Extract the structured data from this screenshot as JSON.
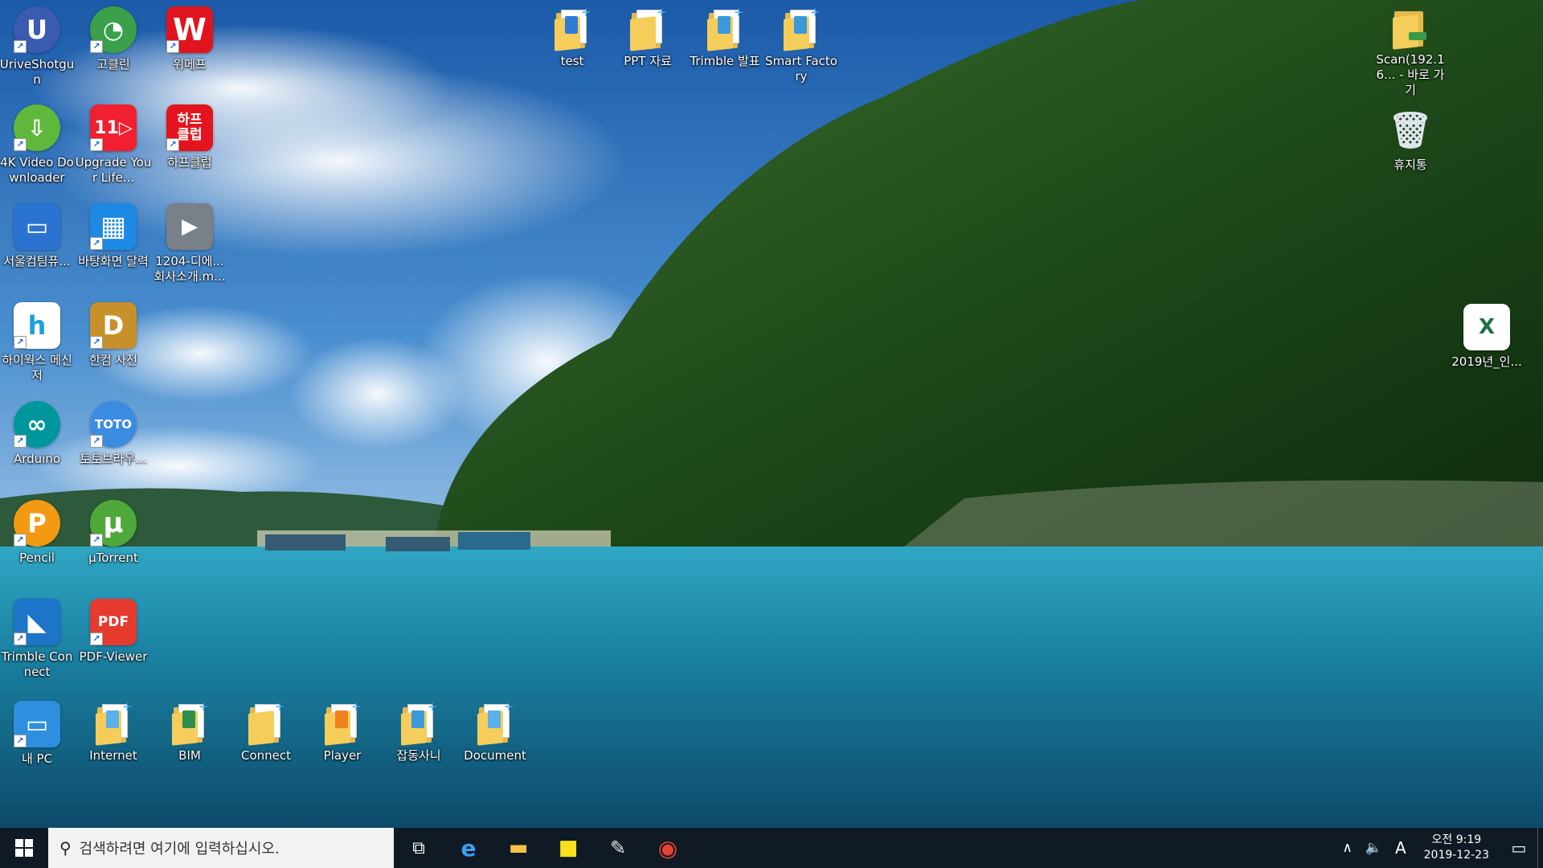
{
  "desktop_icons": [
    {
      "name": "UriveShotgun",
      "label": "UriveShotgun",
      "icon": "uriveshotgun-icon",
      "color": "#3a5bb0",
      "text": "U"
    },
    {
      "name": "gokulin",
      "label": "고클린",
      "icon": "goclean-icon",
      "color": "#3aa14a",
      "text": "◔"
    },
    {
      "name": "wimef",
      "label": "위메프",
      "icon": "wemakeprice-icon",
      "color": "#e0141d",
      "text": "W"
    },
    {
      "name": "4kvideo",
      "label": "4K Video Downloader",
      "icon": "4k-video-downloader-icon",
      "color": "#5fb83c",
      "text": "⇩"
    },
    {
      "name": "upgrade",
      "label": "Upgrade Your Life...",
      "icon": "11st-icon",
      "color": "#f02030",
      "text": "11▷"
    },
    {
      "name": "hapclub",
      "label": "하프클럽",
      "icon": "halfclub-icon",
      "color": "#e3141d",
      "text": "하프\n클럽"
    },
    {
      "name": "seoulcomp",
      "label": "서울컴팀퓨...",
      "icon": "remote-window-icon",
      "color": "#2b73d0",
      "text": "▭"
    },
    {
      "name": "wallcal",
      "label": "바탕화면 달력",
      "icon": "desktop-calendar-icon",
      "color": "#1e88e5",
      "text": "▦"
    },
    {
      "name": "intro",
      "label": "1204-디에... 회사소개.m...",
      "icon": "video-file-icon",
      "color": "#7a8088",
      "text": "▶"
    },
    {
      "name": "hiworks",
      "label": "하이웍스 메신저",
      "icon": "hiworks-icon",
      "color": "#ffffff",
      "text": "h"
    },
    {
      "name": "hancomdict",
      "label": "한컴 사전",
      "icon": "hancom-dictionary-icon",
      "color": "#c8902a",
      "text": "D"
    },
    {
      "name": "arduino",
      "label": "Arduino",
      "icon": "arduino-icon",
      "color": "#00979c",
      "text": "∞"
    },
    {
      "name": "totobrowser",
      "label": "토토브라우...",
      "icon": "toto-browser-icon",
      "color": "#3b8be0",
      "text": "TOTO"
    },
    {
      "name": "pencil",
      "label": "Pencil",
      "icon": "pencil-icon",
      "color": "#f39a12",
      "text": "P"
    },
    {
      "name": "utorrent",
      "label": "µTorrent",
      "icon": "utorrent-icon",
      "color": "#4fa83a",
      "text": "µ"
    },
    {
      "name": "trimbleconnect",
      "label": "Trimble Connect",
      "icon": "trimble-connect-icon",
      "color": "#1c75c9",
      "text": "◣"
    },
    {
      "name": "pdfviewer",
      "label": "PDF-Viewer",
      "icon": "pdf-viewer-icon",
      "color": "#e63a2e",
      "text": "PDF"
    },
    {
      "name": "mypc",
      "label": "내 PC",
      "icon": "computer-icon",
      "color": "#2e8fe0",
      "text": "▭"
    }
  ],
  "folder_icons": [
    {
      "name": "test",
      "label": "test",
      "mark": "#2f7bd6"
    },
    {
      "name": "ppt",
      "label": "PPT 자료",
      "mark": "#f5cd5a"
    },
    {
      "name": "trimble",
      "label": "Trimble 발표",
      "mark": "#3a9ad9"
    },
    {
      "name": "smartfactory",
      "label": "Smart Factory",
      "mark": "#3a9ad9"
    },
    {
      "name": "internet",
      "label": "Internet",
      "mark": "#5ab0e8"
    },
    {
      "name": "bim",
      "label": "BIM",
      "mark": "#2f8f4a"
    },
    {
      "name": "connect",
      "label": "Connect",
      "mark": "#f5cd5a"
    },
    {
      "name": "player",
      "label": "Player",
      "mark": "#f0821e"
    },
    {
      "name": "misc",
      "label": "잡동사니",
      "mark": "#3a9ad9"
    },
    {
      "name": "document",
      "label": "Document",
      "mark": "#5ab0e8"
    }
  ],
  "right_icons": [
    {
      "name": "scan",
      "label": "Scan(192.16... - 바로 가기",
      "icon": "network-folder-shortcut-icon"
    },
    {
      "name": "recycle",
      "label": "휴지통",
      "icon": "recycle-bin-icon"
    },
    {
      "name": "excel2019",
      "label": "2019년_인...",
      "icon": "excel-file-icon"
    }
  ],
  "taskbar": {
    "search_placeholder": "검색하려면 여기에 입력하십시오.",
    "ime": "A",
    "clock_time": "오전 9:19",
    "clock_date": "2019-12-23"
  },
  "colors": {
    "taskbar": "#101a24",
    "search_bg": "#f2f2f2"
  }
}
